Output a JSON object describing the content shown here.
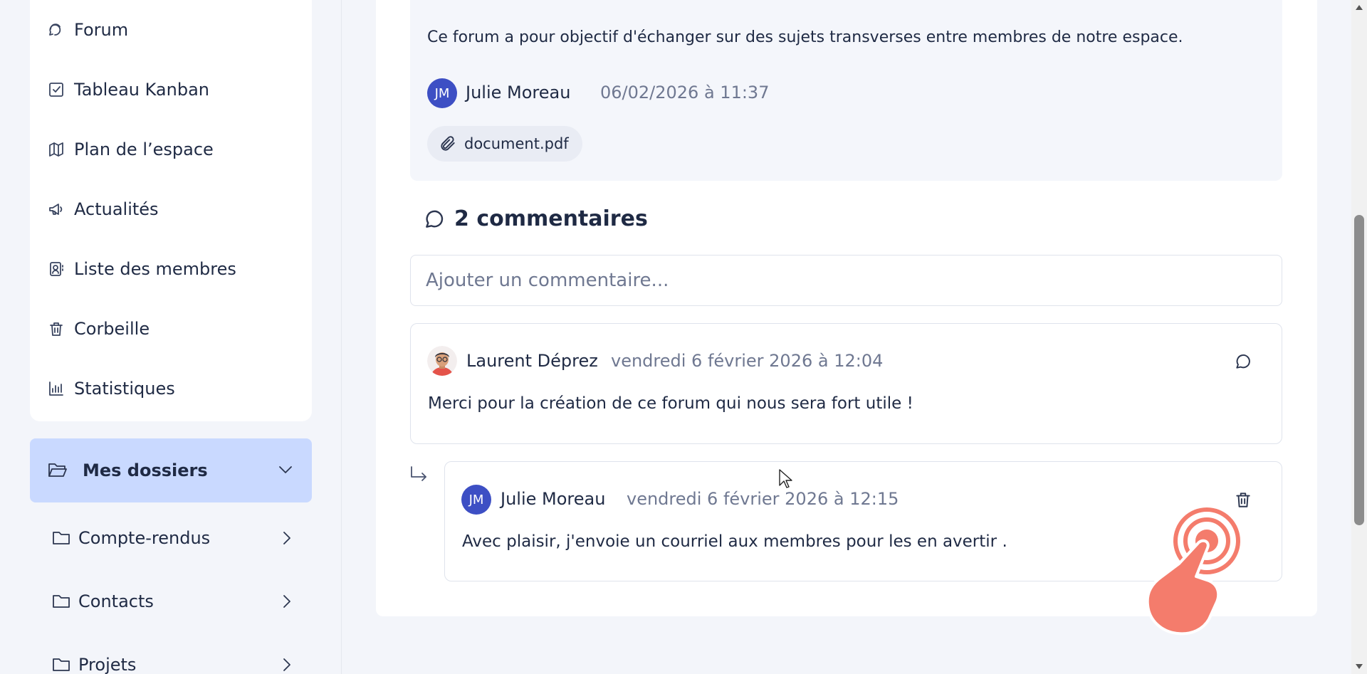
{
  "sidebar": {
    "nav_items": [
      {
        "label": "Forum",
        "icon": "forum-icon"
      },
      {
        "label": "Tableau Kanban",
        "icon": "kanban-icon"
      },
      {
        "label": "Plan de l’espace",
        "icon": "map-icon"
      },
      {
        "label": "Actualités",
        "icon": "megaphone-icon"
      },
      {
        "label": "Liste des membres",
        "icon": "members-icon"
      },
      {
        "label": "Corbeille",
        "icon": "trash-icon"
      },
      {
        "label": "Statistiques",
        "icon": "stats-icon"
      }
    ],
    "folders": {
      "title": "Mes dossiers",
      "items": [
        {
          "label": "Compte-rendus"
        },
        {
          "label": "Contacts"
        },
        {
          "label": "Projets"
        }
      ]
    }
  },
  "post": {
    "text": "Ce forum a pour objectif d'échanger sur des sujets transverses entre membres de notre espace.",
    "author_initials": "JM",
    "author": "Julie Moreau",
    "date": "06/02/2026 à 11:37",
    "attachment": "document.pdf"
  },
  "comments": {
    "count_label": "2 commentaires",
    "input_placeholder": "Ajouter un commentaire...",
    "items": [
      {
        "author": "Laurent Déprez",
        "date": "vendredi 6 février 2026 à 12:04",
        "text": "Merci pour la création de ce forum qui nous sera fort utile !"
      },
      {
        "author_initials": "JM",
        "author": "Julie Moreau",
        "date": "vendredi 6 février 2026 à 12:15",
        "text": "Avec plaisir, j'envoie un courriel aux membres pour les en avertir ."
      }
    ]
  },
  "colors": {
    "accent": "#3d4fc4",
    "folders_highlight": "#c9d9ff",
    "hand_overlay": "#f47c6c"
  }
}
